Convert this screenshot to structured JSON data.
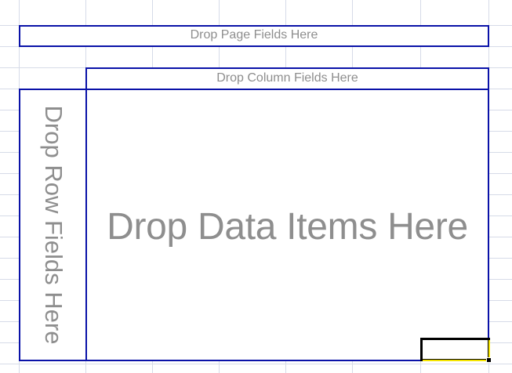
{
  "pivot_table": {
    "page_fields_label": "Drop Page Fields Here",
    "column_fields_label": "Drop Column Fields Here",
    "row_fields_label": "Drop Row Fields Here",
    "data_items_label": "Drop Data Items Here"
  },
  "colors": {
    "zone_border": "#0a12a8",
    "placeholder_text": "#8e8e8e",
    "gridline": "#d6dbe8",
    "selection_border": "#000000",
    "selection_highlight": "#f4e400"
  }
}
